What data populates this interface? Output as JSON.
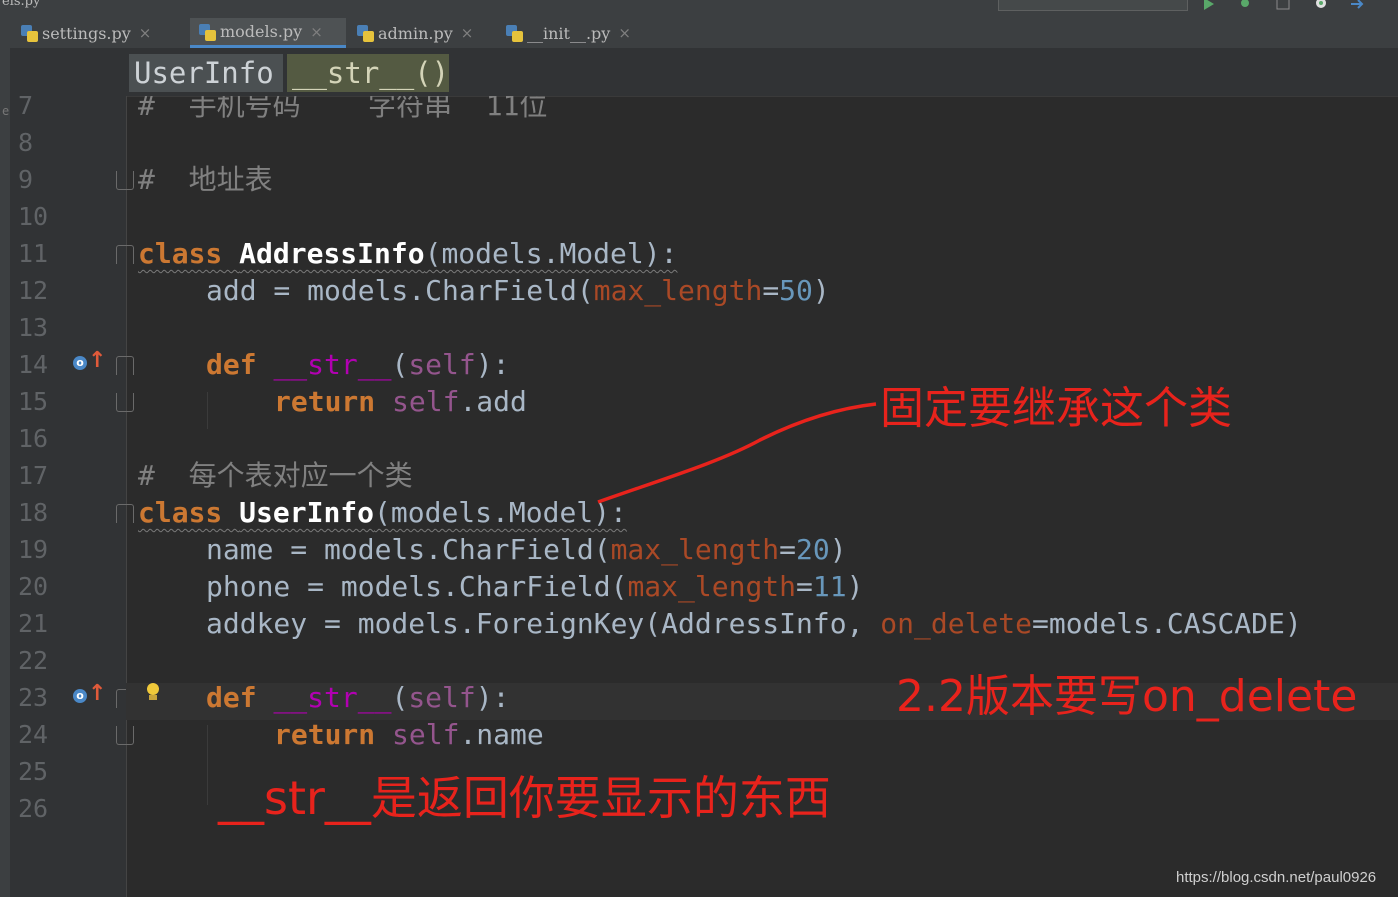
{
  "topbar": {
    "fragment": "els.py"
  },
  "tabs": [
    {
      "label": "settings.py",
      "active": false
    },
    {
      "label": "models.py",
      "active": true
    },
    {
      "label": "admin.py",
      "active": false
    },
    {
      "label": "__init__.py",
      "active": false
    }
  ],
  "close_glyph": "×",
  "left_edge_char": "e",
  "breadcrumb": {
    "class_name": "UserInfo",
    "method_name": "__str__()"
  },
  "line_numbers": [
    "7",
    "8",
    "9",
    "10",
    "11",
    "12",
    "13",
    "14",
    "15",
    "16",
    "17",
    "18",
    "19",
    "20",
    "21",
    "22",
    "23",
    "24",
    "25",
    "26"
  ],
  "code": {
    "l7": "#  手机号码    字符串  11位",
    "l9": "#  地址表",
    "l11_kw": "class",
    "l11_name": "AddressInfo",
    "l11_rest": "(models.Model):",
    "l12_a": "add = models.CharField(",
    "l12_kw": "max_length",
    "l12_eq": "=",
    "l12_num": "50",
    "l12_end": ")",
    "l14_kw": "def",
    "l14_fn": "__str__",
    "l14_p1": "(",
    "l14_self": "self",
    "l14_p2": "):",
    "l15_kw": "return",
    "l15_self": "self",
    "l15_rest": ".add",
    "l17": "#  每个表对应一个类",
    "l18_kw": "class",
    "l18_name": "UserInfo",
    "l18_rest": "(models.Model):",
    "l19_a": "name = models.CharField(",
    "l19_kw": "max_length",
    "l19_eq": "=",
    "l19_num": "20",
    "l19_end": ")",
    "l20_a": "phone = models.CharField(",
    "l20_kw": "max_length",
    "l20_eq": "=",
    "l20_num": "11",
    "l20_end": ")",
    "l21_a": "addkey = models.ForeignKey(AddressInfo, ",
    "l21_kw": "on_delete",
    "l21_rest": "=models.CASCADE)",
    "l23_kw": "def",
    "l23_fn": "__str__",
    "l23_p1": "(",
    "l23_self": "self",
    "l23_p2": "):",
    "l24_kw": "return",
    "l24_self": "self",
    "l24_rest": ".name"
  },
  "annotations": {
    "inherit_note": "固定要继承这个类",
    "version_note": "2.2版本要写on_delete",
    "str_note": "__str__是返回你要显示的东西"
  },
  "watermark": "https://blog.csdn.net/paul0926",
  "colors": {
    "annotation_red": "#e8231c",
    "keyword": "#cc7832",
    "function": "#ffc66d",
    "kwarg": "#aa4926",
    "number": "#6897bb",
    "comment": "#808080"
  }
}
